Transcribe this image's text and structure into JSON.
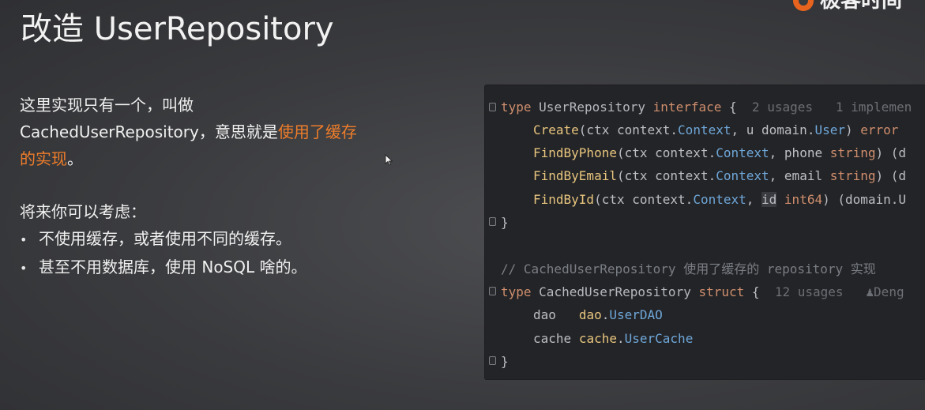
{
  "slide": {
    "title": "改造 UserRepository",
    "logo_text": "极客时间"
  },
  "content": {
    "p1_a": "这里实现只有一个，叫做",
    "p1_b": "CachedUserRepository，意思就是",
    "p1_highlight_a": "使用了缓存",
    "p1_highlight_b": "的实现",
    "p1_end": "。",
    "p2": "将来你可以考虑：",
    "bullets": [
      "不使用缓存，或者使用不同的缓存。",
      "甚至不用数据库，使用 NoSQL 啥的。"
    ],
    "bullet_symbol": "•"
  },
  "code": {
    "l1": {
      "kw": "type",
      "name": "UserRepository",
      "kw2": "interface",
      "brace": "{",
      "hint": "2 usages   1 implemen"
    },
    "l2": {
      "fn": "Create",
      "a": "(ctx ",
      "b": "context",
      "c": ".",
      "d": "Context",
      "e": ", u ",
      "f": "domain",
      "g": ".",
      "h": "User",
      "i": ") ",
      "j": "error"
    },
    "l3": {
      "fn": "FindByPhone",
      "a": "(ctx ",
      "b": "context",
      "c": ".",
      "d": "Context",
      "e": ", phone ",
      "f": "string",
      "g": ") (d"
    },
    "l4": {
      "fn": "FindByEmail",
      "a": "(ctx ",
      "b": "context",
      "c": ".",
      "d": "Context",
      "e": ", email ",
      "f": "string",
      "g": ") (d"
    },
    "l5": {
      "fn": "FindById",
      "a": "(ctx ",
      "b": "context",
      "c": ".",
      "d": "Context",
      "e": ", ",
      "f": "id",
      "g": " ",
      "h": "int64",
      "i": ") (domain.U"
    },
    "l6": "}",
    "l8": "// CachedUserRepository 使用了缓存的 repository 实现",
    "l9": {
      "kw": "type",
      "name": "CachedUserRepository",
      "kw2": "struct",
      "brace": "{",
      "hint": "12 usages   ",
      "author_icon": "person-icon",
      "author": "Deng"
    },
    "l10": {
      "field": "dao",
      "pad": "   ",
      "pkg": "dao",
      "dot": ".",
      "t": "UserDAO"
    },
    "l11": {
      "field": "cache",
      "pad": " ",
      "pkg": "cache",
      "dot": ".",
      "t": "UserCache"
    },
    "l12": "}"
  }
}
